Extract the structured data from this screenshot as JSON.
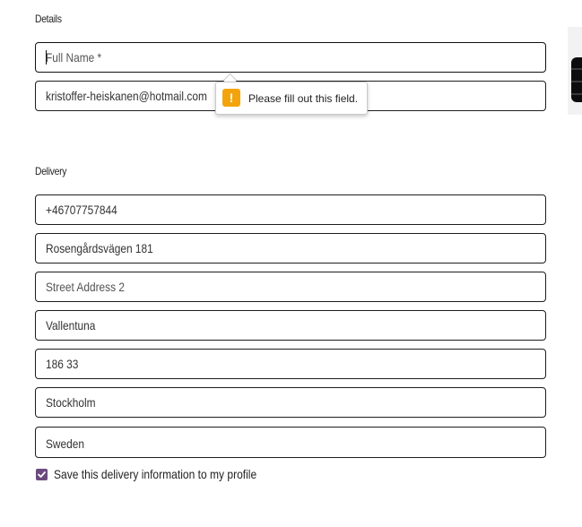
{
  "details": {
    "heading": "Details",
    "full_name": {
      "value": "",
      "placeholder": "Full Name *"
    },
    "email": {
      "value": "kristoffer-heiskanen@hotmail.com"
    }
  },
  "validation_tooltip": {
    "icon": "warning-icon",
    "icon_glyph": "!",
    "message": "Please fill out this field.",
    "color": "#f3a40d"
  },
  "delivery": {
    "heading": "Delivery",
    "phone": {
      "value": "+46707757844"
    },
    "street_address_1": {
      "value": "Rosengårdsvägen 181"
    },
    "street_address_2": {
      "value": "",
      "placeholder": "Street Address 2"
    },
    "town_or_city": {
      "value": "Vallentuna"
    },
    "postcode": {
      "value": "186 33"
    },
    "county": {
      "value": "Stockholm"
    },
    "country": {
      "value": "Sweden"
    }
  },
  "save_info": {
    "checked": true,
    "label": "Save this delivery information to my profile",
    "color": "#6b4a7e"
  }
}
